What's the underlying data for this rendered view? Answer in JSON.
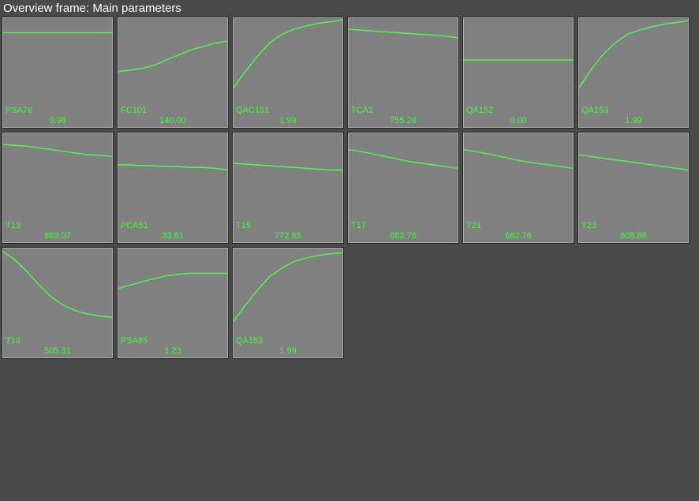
{
  "title": "Overview frame: Main parameters",
  "colors": {
    "accent": "#3cff3c",
    "bg": "#4a4a4a",
    "cell": "#808080"
  },
  "chart_data": [
    {
      "type": "line",
      "tag": "PSA76",
      "value": "0.98",
      "series": [
        18,
        18,
        18,
        18,
        18,
        18,
        18,
        18,
        18,
        18
      ],
      "title": "PSA76",
      "xlabel": "",
      "ylabel": "",
      "ylim": [
        0,
        100
      ]
    },
    {
      "type": "line",
      "tag": "FC101",
      "value": "140.00",
      "series": [
        64,
        62,
        60,
        56,
        50,
        44,
        38,
        34,
        30,
        28
      ],
      "title": "FC101",
      "xlabel": "",
      "ylabel": "",
      "ylim": [
        0,
        100
      ]
    },
    {
      "type": "line",
      "tag": "QAC151",
      "value": "1.99",
      "series": [
        84,
        64,
        46,
        30,
        20,
        14,
        10,
        7,
        5,
        3
      ],
      "title": "QAC151",
      "xlabel": "",
      "ylabel": "",
      "ylim": [
        0,
        100
      ]
    },
    {
      "type": "line",
      "tag": "TCA1",
      "value": "755.28",
      "series": [
        14,
        15,
        16,
        17,
        18,
        19,
        20,
        21,
        22,
        24
      ],
      "title": "TCA1",
      "xlabel": "",
      "ylabel": "",
      "ylim": [
        0,
        100
      ]
    },
    {
      "type": "line",
      "tag": "QA152",
      "value": "0.00",
      "series": [
        50,
        50,
        50,
        50,
        50,
        50,
        50,
        50,
        50,
        50
      ],
      "title": "QA152",
      "xlabel": "",
      "ylabel": "",
      "ylim": [
        0,
        100
      ]
    },
    {
      "type": "line",
      "tag": "QA153",
      "value": "1.99",
      "series": [
        84,
        62,
        44,
        30,
        20,
        15,
        11,
        8,
        6,
        4
      ],
      "title": "QA153",
      "xlabel": "",
      "ylabel": "",
      "ylim": [
        0,
        100
      ]
    },
    {
      "type": "line",
      "tag": "T13",
      "value": "883.07",
      "series": [
        14,
        15,
        16,
        18,
        20,
        22,
        24,
        26,
        27,
        28
      ],
      "title": "T13",
      "xlabel": "",
      "ylabel": "",
      "ylim": [
        0,
        100
      ]
    },
    {
      "type": "line",
      "tag": "PCA51",
      "value": "33.61",
      "series": [
        38,
        38,
        39,
        39,
        40,
        40,
        41,
        41,
        42,
        44
      ],
      "title": "PCA51",
      "xlabel": "",
      "ylabel": "",
      "ylim": [
        0,
        100
      ]
    },
    {
      "type": "line",
      "tag": "T15",
      "value": "772.65",
      "series": [
        36,
        37,
        38,
        39,
        40,
        41,
        42,
        43,
        44,
        44
      ],
      "title": "T15",
      "xlabel": "",
      "ylabel": "",
      "ylim": [
        0,
        100
      ]
    },
    {
      "type": "line",
      "tag": "T17",
      "value": "682.76",
      "series": [
        20,
        22,
        25,
        28,
        31,
        34,
        36,
        38,
        40,
        42
      ],
      "title": "T17",
      "xlabel": "",
      "ylabel": "",
      "ylim": [
        0,
        100
      ]
    },
    {
      "type": "line",
      "tag": "T21",
      "value": "682.76",
      "series": [
        20,
        22,
        25,
        28,
        31,
        34,
        36,
        38,
        40,
        42
      ],
      "title": "T21",
      "xlabel": "",
      "ylabel": "",
      "ylim": [
        0,
        100
      ]
    },
    {
      "type": "line",
      "tag": "T23",
      "value": "608.86",
      "series": [
        26,
        28,
        30,
        32,
        34,
        36,
        38,
        40,
        42,
        44
      ],
      "title": "T23",
      "xlabel": "",
      "ylabel": "",
      "ylim": [
        0,
        100
      ]
    },
    {
      "type": "line",
      "tag": "T19",
      "value": "505.31",
      "series": [
        4,
        14,
        28,
        44,
        58,
        68,
        74,
        78,
        80,
        82
      ],
      "title": "T19",
      "xlabel": "",
      "ylabel": "",
      "ylim": [
        0,
        100
      ]
    },
    {
      "type": "line",
      "tag": "PSA85",
      "value": "1.23",
      "series": [
        48,
        44,
        40,
        36,
        33,
        31,
        30,
        30,
        30,
        30
      ],
      "title": "PSA85",
      "xlabel": "",
      "ylabel": "",
      "ylim": [
        0,
        100
      ]
    },
    {
      "type": "line",
      "tag": "QA153",
      "value": "1.99",
      "series": [
        88,
        68,
        50,
        34,
        24,
        16,
        12,
        9,
        7,
        6
      ],
      "title": "QA153",
      "xlabel": "",
      "ylabel": "",
      "ylim": [
        0,
        100
      ]
    }
  ]
}
